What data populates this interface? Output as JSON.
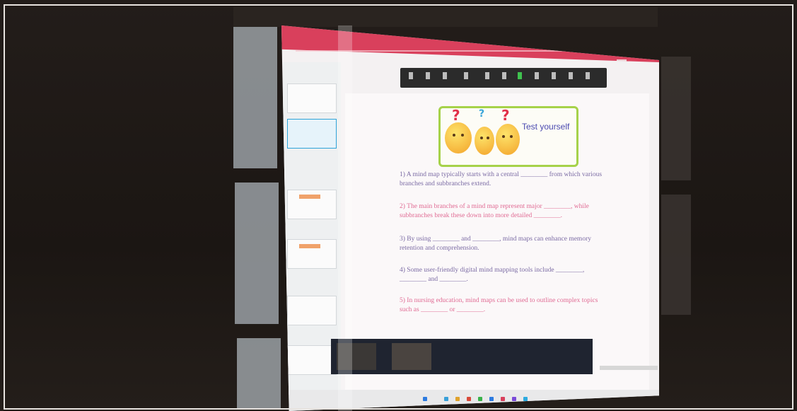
{
  "scene": {
    "description_kind": "photo of projected Zoom PowerPoint slide",
    "accent_pink": "#d9405c",
    "highlight_green": "#a6d24a"
  },
  "slide": {
    "heading": "Test yourself",
    "questions": [
      {
        "num": "1)",
        "text": "A mind map typically starts with a central ________ from which various branches and subbranches extend.",
        "color": "violet"
      },
      {
        "num": "2)",
        "text": "The main branches of a mind map represent major ________, while subbranches break these down into more detailed ________.",
        "color": "pink"
      },
      {
        "num": "3)",
        "text": "By using ________ and ________, mind maps can enhance memory retention and comprehension.",
        "color": "violet"
      },
      {
        "num": "4)",
        "text": "Some user-friendly digital mind mapping tools include ________, ________ and ________.",
        "color": "violet"
      },
      {
        "num": "5)",
        "text": "In nursing education, mind maps can be used to outline complex topics such as ________ or ________.",
        "color": "pink"
      }
    ]
  }
}
